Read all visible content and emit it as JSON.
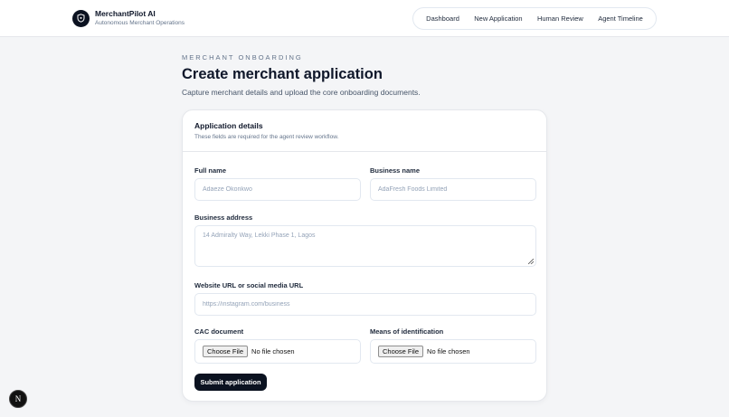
{
  "brand": {
    "name": "MerchantPilot AI",
    "subtitle": "Autonomous Merchant Operations",
    "logo_icon": "shield-icon"
  },
  "nav": {
    "items": [
      "Dashboard",
      "New Application",
      "Human Review",
      "Agent Timeline"
    ]
  },
  "page": {
    "eyebrow": "MERCHANT ONBOARDING",
    "title": "Create merchant application",
    "subtitle": "Capture merchant details and upload the core onboarding documents."
  },
  "card": {
    "title": "Application details",
    "subtitle": "These fields are required for the agent review workflow."
  },
  "form": {
    "full_name": {
      "label": "Full name",
      "placeholder": "Adaeze Okonkwo",
      "value": ""
    },
    "business_name": {
      "label": "Business name",
      "placeholder": "AdaFresh Foods Limited",
      "value": ""
    },
    "business_address": {
      "label": "Business address",
      "placeholder": "14 Admiralty Way, Lekki Phase 1, Lagos",
      "value": ""
    },
    "website": {
      "label": "Website URL or social media URL",
      "placeholder": "https://instagram.com/business",
      "value": ""
    },
    "cac_document": {
      "label": "CAC document",
      "button": "Choose File",
      "status": "No file chosen"
    },
    "identification": {
      "label": "Means of identification",
      "button": "Choose File",
      "status": "No file chosen"
    },
    "submit_label": "Submit application"
  },
  "floating_badge": {
    "label": "N"
  },
  "colors": {
    "background": "#f4f5f7",
    "primary": "#0b1220",
    "border": "#e2e8f0",
    "muted_text": "#64748b"
  }
}
